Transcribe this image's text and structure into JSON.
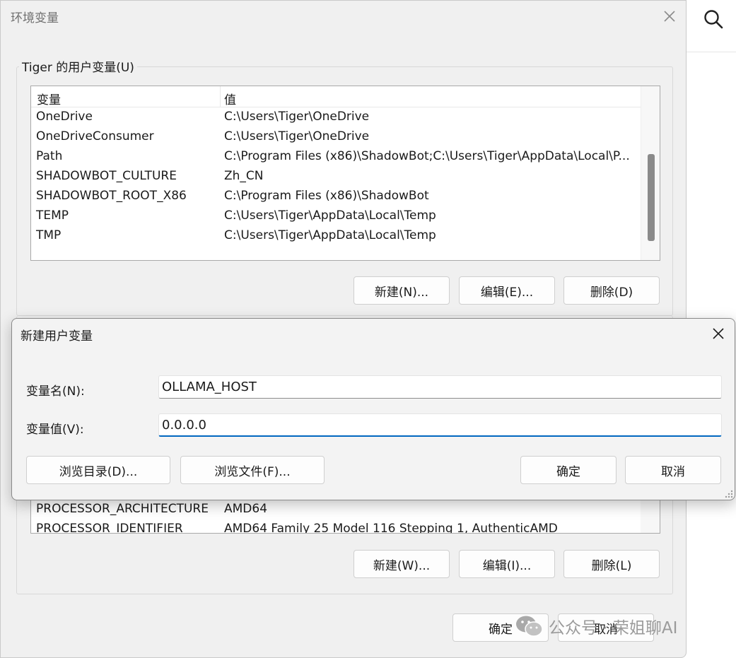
{
  "env_dialog": {
    "title": "环境变量",
    "user_group_label": "Tiger 的用户变量(U)",
    "columns": [
      "变量",
      "值"
    ],
    "user_vars": [
      {
        "name": "OneDrive",
        "value": "C:\\Users\\Tiger\\OneDrive"
      },
      {
        "name": "OneDriveConsumer",
        "value": "C:\\Users\\Tiger\\OneDrive"
      },
      {
        "name": "Path",
        "value": "C:\\Program Files (x86)\\ShadowBot;C:\\Users\\Tiger\\AppData\\Local\\P..."
      },
      {
        "name": "SHADOWBOT_CULTURE",
        "value": "Zh_CN"
      },
      {
        "name": "SHADOWBOT_ROOT_X86",
        "value": "C:\\Program Files (x86)\\ShadowBot"
      },
      {
        "name": "TEMP",
        "value": "C:\\Users\\Tiger\\AppData\\Local\\Temp"
      },
      {
        "name": "TMP",
        "value": "C:\\Users\\Tiger\\AppData\\Local\\Temp"
      }
    ],
    "user_buttons": {
      "new": "新建(N)...",
      "edit": "编辑(E)...",
      "delete": "删除(D)"
    },
    "sys_vars": [
      {
        "name": "PROCESSOR_ARCHITECTURE",
        "value": "AMD64"
      },
      {
        "name": "PROCESSOR_IDENTIFIER",
        "value": "AMD64 Family 25 Model 116 Stepping 1, AuthenticAMD"
      }
    ],
    "sys_buttons": {
      "new": "新建(W)...",
      "edit": "编辑(I)...",
      "delete": "删除(L)"
    },
    "ok": "确定",
    "cancel": "取消"
  },
  "new_var_dialog": {
    "title": "新建用户变量",
    "name_label": "变量名(N):",
    "value_label": "变量值(V):",
    "name_value": "OLLAMA_HOST",
    "value_value": "0.0.0.0",
    "browse_dir": "浏览目录(D)...",
    "browse_file": "浏览文件(F)...",
    "ok": "确定",
    "cancel": "取消"
  },
  "watermark": {
    "text": "公众号 · 荣姐聊AI"
  },
  "icons": {
    "search": "search-icon",
    "close": "close-icon",
    "resize": "resize-grip-icon",
    "wechat": "wechat-logo-icon"
  }
}
